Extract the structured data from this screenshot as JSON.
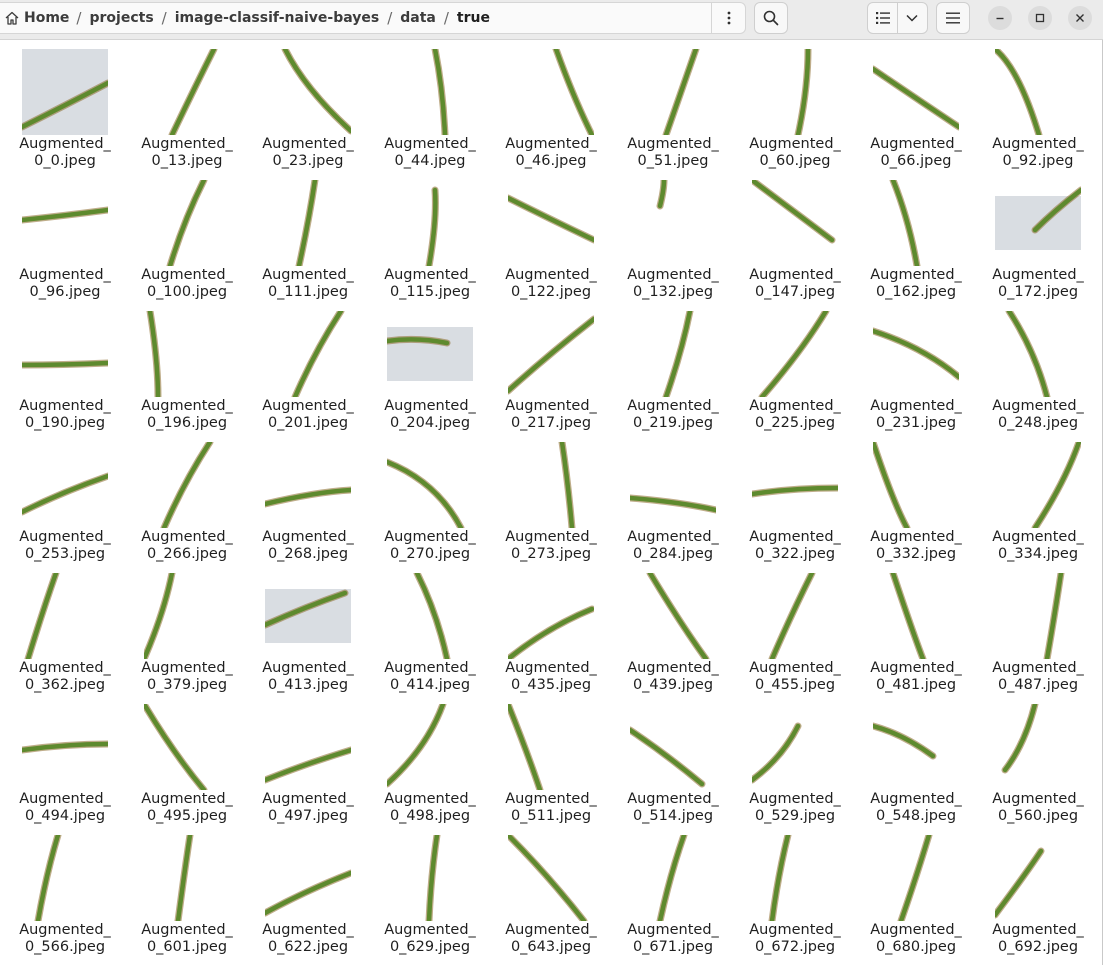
{
  "pathbar": {
    "crumbs": [
      "Home",
      "projects",
      "image-classif-naive-bayes",
      "data",
      "true"
    ],
    "separator": "/",
    "menu_icon": "vertical-dots-icon"
  },
  "headerbar": {
    "search_icon": "search-icon",
    "view_icon": "list-view-icon",
    "view_dropdown_icon": "chevron-down-icon",
    "menu_icon": "hamburger-menu-icon",
    "window_controls": [
      "minimize-icon",
      "maximize-icon",
      "close-icon"
    ]
  },
  "files": [
    {
      "l1": "Augmented_",
      "l2": "0_0.jpeg"
    },
    {
      "l1": "Augmented_",
      "l2": "0_13.jpeg"
    },
    {
      "l1": "Augmented_",
      "l2": "0_23.jpeg"
    },
    {
      "l1": "Augmented_",
      "l2": "0_44.jpeg"
    },
    {
      "l1": "Augmented_",
      "l2": "0_46.jpeg"
    },
    {
      "l1": "Augmented_",
      "l2": "0_51.jpeg"
    },
    {
      "l1": "Augmented_",
      "l2": "0_60.jpeg"
    },
    {
      "l1": "Augmented_",
      "l2": "0_66.jpeg"
    },
    {
      "l1": "Augmented_",
      "l2": "0_92.jpeg"
    },
    {
      "l1": "Augmented_",
      "l2": "0_96.jpeg"
    },
    {
      "l1": "Augmented_",
      "l2": "0_100.jpeg"
    },
    {
      "l1": "Augmented_",
      "l2": "0_111.jpeg"
    },
    {
      "l1": "Augmented_",
      "l2": "0_115.jpeg"
    },
    {
      "l1": "Augmented_",
      "l2": "0_122.jpeg"
    },
    {
      "l1": "Augmented_",
      "l2": "0_132.jpeg"
    },
    {
      "l1": "Augmented_",
      "l2": "0_147.jpeg"
    },
    {
      "l1": "Augmented_",
      "l2": "0_162.jpeg"
    },
    {
      "l1": "Augmented_",
      "l2": "0_172.jpeg"
    },
    {
      "l1": "Augmented_",
      "l2": "0_190.jpeg"
    },
    {
      "l1": "Augmented_",
      "l2": "0_196.jpeg"
    },
    {
      "l1": "Augmented_",
      "l2": "0_201.jpeg"
    },
    {
      "l1": "Augmented_",
      "l2": "0_204.jpeg"
    },
    {
      "l1": "Augmented_",
      "l2": "0_217.jpeg"
    },
    {
      "l1": "Augmented_",
      "l2": "0_219.jpeg"
    },
    {
      "l1": "Augmented_",
      "l2": "0_225.jpeg"
    },
    {
      "l1": "Augmented_",
      "l2": "0_231.jpeg"
    },
    {
      "l1": "Augmented_",
      "l2": "0_248.jpeg"
    },
    {
      "l1": "Augmented_",
      "l2": "0_253.jpeg"
    },
    {
      "l1": "Augmented_",
      "l2": "0_266.jpeg"
    },
    {
      "l1": "Augmented_",
      "l2": "0_268.jpeg"
    },
    {
      "l1": "Augmented_",
      "l2": "0_270.jpeg"
    },
    {
      "l1": "Augmented_",
      "l2": "0_273.jpeg"
    },
    {
      "l1": "Augmented_",
      "l2": "0_284.jpeg"
    },
    {
      "l1": "Augmented_",
      "l2": "0_322.jpeg"
    },
    {
      "l1": "Augmented_",
      "l2": "0_332.jpeg"
    },
    {
      "l1": "Augmented_",
      "l2": "0_334.jpeg"
    },
    {
      "l1": "Augmented_",
      "l2": "0_362.jpeg"
    },
    {
      "l1": "Augmented_",
      "l2": "0_379.jpeg"
    },
    {
      "l1": "Augmented_",
      "l2": "0_413.jpeg"
    },
    {
      "l1": "Augmented_",
      "l2": "0_414.jpeg"
    },
    {
      "l1": "Augmented_",
      "l2": "0_435.jpeg"
    },
    {
      "l1": "Augmented_",
      "l2": "0_439.jpeg"
    },
    {
      "l1": "Augmented_",
      "l2": "0_455.jpeg"
    },
    {
      "l1": "Augmented_",
      "l2": "0_481.jpeg"
    },
    {
      "l1": "Augmented_",
      "l2": "0_487.jpeg"
    },
    {
      "l1": "Augmented_",
      "l2": "0_494.jpeg"
    },
    {
      "l1": "Augmented_",
      "l2": "0_495.jpeg"
    },
    {
      "l1": "Augmented_",
      "l2": "0_497.jpeg"
    },
    {
      "l1": "Augmented_",
      "l2": "0_498.jpeg"
    },
    {
      "l1": "Augmented_",
      "l2": "0_511.jpeg"
    },
    {
      "l1": "Augmented_",
      "l2": "0_514.jpeg"
    },
    {
      "l1": "Augmented_",
      "l2": "0_529.jpeg"
    },
    {
      "l1": "Augmented_",
      "l2": "0_548.jpeg"
    },
    {
      "l1": "Augmented_",
      "l2": "0_560.jpeg"
    },
    {
      "l1": "Augmented_",
      "l2": "0_566.jpeg"
    },
    {
      "l1": "Augmented_",
      "l2": "0_601.jpeg"
    },
    {
      "l1": "Augmented_",
      "l2": "0_622.jpeg"
    },
    {
      "l1": "Augmented_",
      "l2": "0_629.jpeg"
    },
    {
      "l1": "Augmented_",
      "l2": "0_643.jpeg"
    },
    {
      "l1": "Augmented_",
      "l2": "0_671.jpeg"
    },
    {
      "l1": "Augmented_",
      "l2": "0_672.jpeg"
    },
    {
      "l1": "Augmented_",
      "l2": "0_680.jpeg"
    },
    {
      "l1": "Augmented_",
      "l2": "0_692.jpeg"
    }
  ],
  "colors": {
    "leaf_green": "#5e8a2e",
    "leaf_brown": "#8a6a2a",
    "photo_bg": "#d9dde2"
  }
}
